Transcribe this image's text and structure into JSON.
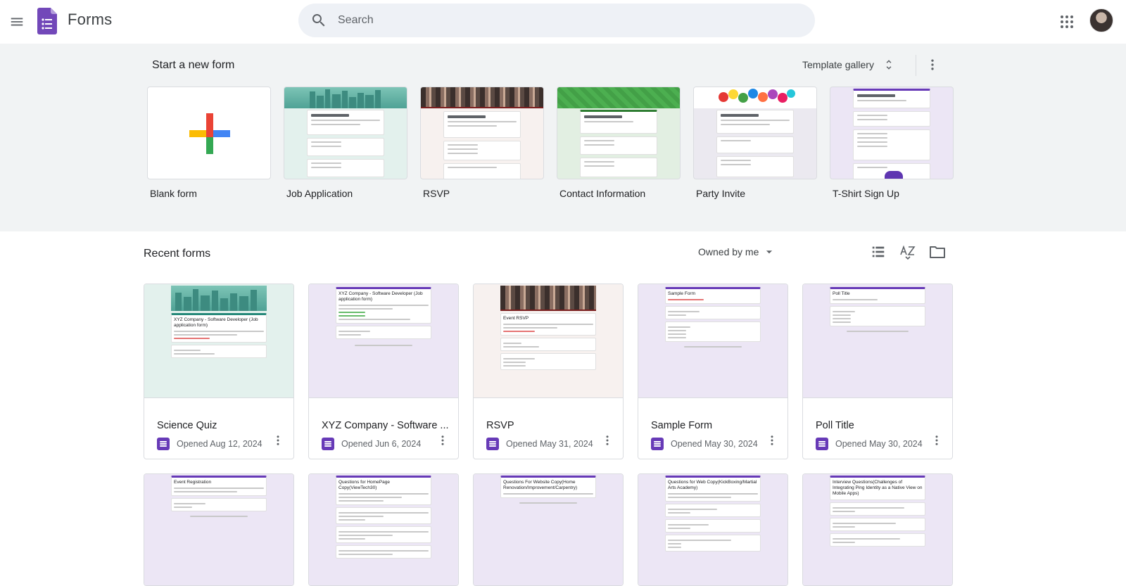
{
  "app": {
    "title": "Forms"
  },
  "search": {
    "placeholder": "Search"
  },
  "start": {
    "title": "Start a new form",
    "gallery_label": "Template gallery",
    "templates": [
      {
        "label": "Blank form"
      },
      {
        "label": "Job Application"
      },
      {
        "label": "RSVP"
      },
      {
        "label": "Contact Information"
      },
      {
        "label": "Party Invite"
      },
      {
        "label": "T-Shirt Sign Up"
      }
    ]
  },
  "recent": {
    "title": "Recent forms",
    "owner_filter": "Owned by me",
    "forms": [
      {
        "title": "Science Quiz",
        "date": "Opened Aug 12, 2024",
        "thumb_title": "XYZ Company - Software Developer (Job application form)"
      },
      {
        "title": "XYZ Company - Software ...",
        "date": "Opened Jun 6, 2024",
        "thumb_title": "XYZ Company - Software Developer (Job application form)"
      },
      {
        "title": "RSVP",
        "date": "Opened May 31, 2024",
        "thumb_title": "Event RSVP"
      },
      {
        "title": "Sample Form",
        "date": "Opened May 30, 2024",
        "thumb_title": "Sample Form"
      },
      {
        "title": "Poll Title",
        "date": "Opened May 30, 2024",
        "thumb_title": "Poll Title"
      }
    ],
    "forms_row2": [
      {
        "thumb_title": "Event Registration"
      },
      {
        "thumb_title": "Questions for HomePage Copy(ViewTech30)"
      },
      {
        "thumb_title": "Questions For Website Copy(Home Renovation/Improvement/Carpentry)"
      },
      {
        "thumb_title": "Questions for Web Copy(KickBoxing/Martial Arts Academy)"
      },
      {
        "thumb_title": "Interview Questions(Challenges of Integrating Ping Identity as a Native View on Mobile Apps)"
      }
    ]
  },
  "colors": {
    "forms_purple": "#673ab7",
    "background_band": "#f1f3f4",
    "search_bg": "#eef1f6",
    "thumb_lavender": "#ece6f5",
    "thumb_mint": "#e3f1ed"
  },
  "icons": [
    "menu-icon",
    "forms-logo-icon",
    "search-icon",
    "apps-grid-icon",
    "unfold-icon",
    "more-vert-icon",
    "arrow-drop-down-icon",
    "list-view-icon",
    "sort-az-icon",
    "folder-icon"
  ]
}
